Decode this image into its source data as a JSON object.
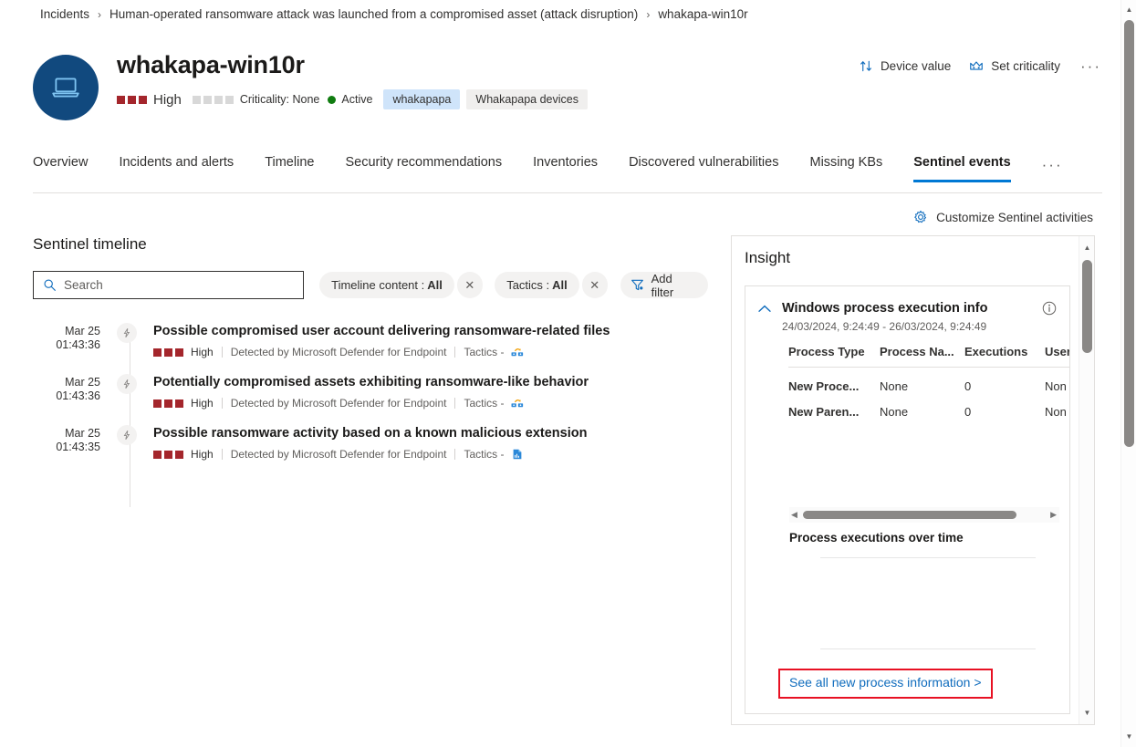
{
  "breadcrumb": {
    "items": [
      "Incidents",
      "Human-operated ransomware attack was launched from a compromised asset (attack disruption)",
      "whakapa-win10r"
    ],
    "separator": "›"
  },
  "header": {
    "device_icon": "laptop-icon",
    "title": "whakapa-win10r",
    "severity_label": "High",
    "severity_filled": 3,
    "severity_total": 3,
    "severity_color": "#a4262c",
    "criticality_label": "Criticality: None",
    "criticality_filled": 0,
    "criticality_total": 4,
    "criticality_empty_color": "#d8d8d8",
    "status_label": "Active",
    "status_color": "#107c10",
    "tags": [
      {
        "label": "whakapapa",
        "style": "blue"
      },
      {
        "label": "Whakapapa devices",
        "style": "grey"
      }
    ],
    "actions": [
      {
        "label": "Device value",
        "icon": "sort-arrows-icon"
      },
      {
        "label": "Set criticality",
        "icon": "crown-icon"
      }
    ],
    "overflow_label": "···"
  },
  "tabs": {
    "items": [
      {
        "label": "Overview",
        "active": false
      },
      {
        "label": "Incidents and alerts",
        "active": false
      },
      {
        "label": "Timeline",
        "active": false
      },
      {
        "label": "Security recommendations",
        "active": false
      },
      {
        "label": "Inventories",
        "active": false
      },
      {
        "label": "Discovered vulnerabilities",
        "active": false
      },
      {
        "label": "Missing KBs",
        "active": false
      },
      {
        "label": "Sentinel events",
        "active": true
      }
    ],
    "overflow_label": "···",
    "active_underline_color": "#0078d4"
  },
  "customize": {
    "label": "Customize Sentinel activities",
    "icon": "gear-icon"
  },
  "timeline_section": {
    "title": "Sentinel timeline",
    "search": {
      "placeholder": "Search",
      "value": "",
      "icon": "search-icon"
    },
    "filters": [
      {
        "label": "Timeline content :",
        "value": "All",
        "clear": "✕"
      },
      {
        "label": "Tactics :",
        "value": "All",
        "clear": "✕"
      }
    ],
    "add_filter": {
      "label": "Add filter",
      "icon": "funnel-icon"
    },
    "events": [
      {
        "date": "Mar 25",
        "time": "01:43:36",
        "icon": "lightning-bolt-icon",
        "title": "Possible compromised user account delivering ransomware-related files",
        "severity": "High",
        "severity_squares": 3,
        "detected_by": "Detected by Microsoft Defender for Endpoint",
        "tactics_label": "Tactics -",
        "tactics_icon": "lateral-movement-icon"
      },
      {
        "date": "Mar 25",
        "time": "01:43:36",
        "icon": "lightning-bolt-icon",
        "title": "Potentially compromised assets exhibiting ransomware-like behavior",
        "severity": "High",
        "severity_squares": 3,
        "detected_by": "Detected by Microsoft Defender for Endpoint",
        "tactics_label": "Tactics -",
        "tactics_icon": "lateral-movement-icon"
      },
      {
        "date": "Mar 25",
        "time": "01:43:35",
        "icon": "lightning-bolt-icon",
        "title": "Possible ransomware activity based on a known malicious extension",
        "severity": "High",
        "severity_squares": 3,
        "detected_by": "Detected by Microsoft Defender for Endpoint",
        "tactics_label": "Tactics -",
        "tactics_icon": "impact-document-icon"
      }
    ]
  },
  "insight": {
    "panel_title": "Insight",
    "card": {
      "collapse_icon": "chevron-up-icon",
      "title": "Windows process execution info",
      "info_icon": "info-circle-icon",
      "date_range": "24/03/2024, 9:24:49 - 26/03/2024, 9:24:49",
      "table": {
        "columns": [
          "Process Type",
          "Process Na...",
          "Executions",
          "User"
        ],
        "rows": [
          [
            "New Proce...",
            "None",
            "0",
            "Non"
          ],
          [
            "New Paren...",
            "None",
            "0",
            "Non"
          ]
        ]
      },
      "hscroll": {
        "left_arrow": "◀",
        "right_arrow": "▶"
      },
      "chart_title": "Process executions over time",
      "see_all_label": "See all new process information >",
      "see_all_color": "#0f6cbd",
      "highlight_color": "#e81123"
    },
    "scroll": {
      "up_arrow": "▲",
      "down_arrow": "▼"
    }
  },
  "page_scroll": {
    "up_arrow": "▲",
    "down_arrow": "▼"
  },
  "chart_data": {
    "type": "line",
    "title": "Process executions over time",
    "x": [],
    "values": [],
    "series": [],
    "xlabel": "",
    "ylabel": "",
    "grid": true,
    "gridlines": 2,
    "note": "empty chart - no data plotted"
  }
}
